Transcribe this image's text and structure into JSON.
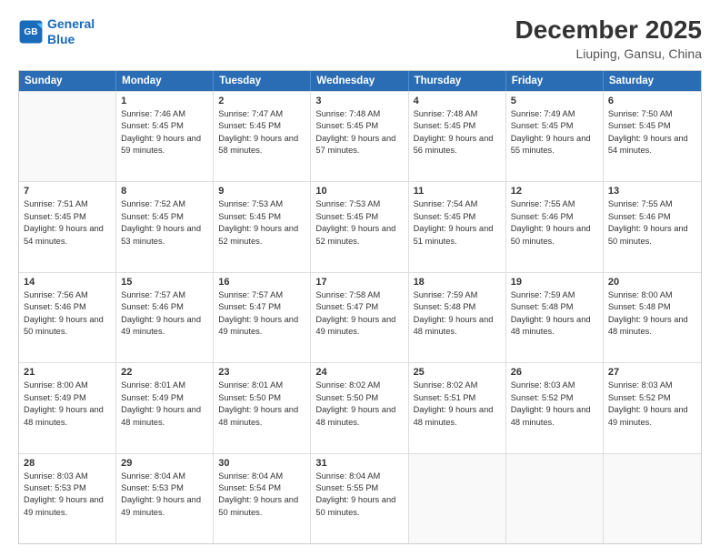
{
  "header": {
    "logo_line1": "General",
    "logo_line2": "Blue",
    "title": "December 2025",
    "subtitle": "Liuping, Gansu, China"
  },
  "weekdays": [
    "Sunday",
    "Monday",
    "Tuesday",
    "Wednesday",
    "Thursday",
    "Friday",
    "Saturday"
  ],
  "weeks": [
    [
      {
        "day": "",
        "sunrise": "",
        "sunset": "",
        "daylight": ""
      },
      {
        "day": "1",
        "sunrise": "Sunrise: 7:46 AM",
        "sunset": "Sunset: 5:45 PM",
        "daylight": "Daylight: 9 hours and 59 minutes."
      },
      {
        "day": "2",
        "sunrise": "Sunrise: 7:47 AM",
        "sunset": "Sunset: 5:45 PM",
        "daylight": "Daylight: 9 hours and 58 minutes."
      },
      {
        "day": "3",
        "sunrise": "Sunrise: 7:48 AM",
        "sunset": "Sunset: 5:45 PM",
        "daylight": "Daylight: 9 hours and 57 minutes."
      },
      {
        "day": "4",
        "sunrise": "Sunrise: 7:48 AM",
        "sunset": "Sunset: 5:45 PM",
        "daylight": "Daylight: 9 hours and 56 minutes."
      },
      {
        "day": "5",
        "sunrise": "Sunrise: 7:49 AM",
        "sunset": "Sunset: 5:45 PM",
        "daylight": "Daylight: 9 hours and 55 minutes."
      },
      {
        "day": "6",
        "sunrise": "Sunrise: 7:50 AM",
        "sunset": "Sunset: 5:45 PM",
        "daylight": "Daylight: 9 hours and 54 minutes."
      }
    ],
    [
      {
        "day": "7",
        "sunrise": "Sunrise: 7:51 AM",
        "sunset": "Sunset: 5:45 PM",
        "daylight": "Daylight: 9 hours and 54 minutes."
      },
      {
        "day": "8",
        "sunrise": "Sunrise: 7:52 AM",
        "sunset": "Sunset: 5:45 PM",
        "daylight": "Daylight: 9 hours and 53 minutes."
      },
      {
        "day": "9",
        "sunrise": "Sunrise: 7:53 AM",
        "sunset": "Sunset: 5:45 PM",
        "daylight": "Daylight: 9 hours and 52 minutes."
      },
      {
        "day": "10",
        "sunrise": "Sunrise: 7:53 AM",
        "sunset": "Sunset: 5:45 PM",
        "daylight": "Daylight: 9 hours and 52 minutes."
      },
      {
        "day": "11",
        "sunrise": "Sunrise: 7:54 AM",
        "sunset": "Sunset: 5:45 PM",
        "daylight": "Daylight: 9 hours and 51 minutes."
      },
      {
        "day": "12",
        "sunrise": "Sunrise: 7:55 AM",
        "sunset": "Sunset: 5:46 PM",
        "daylight": "Daylight: 9 hours and 50 minutes."
      },
      {
        "day": "13",
        "sunrise": "Sunrise: 7:55 AM",
        "sunset": "Sunset: 5:46 PM",
        "daylight": "Daylight: 9 hours and 50 minutes."
      }
    ],
    [
      {
        "day": "14",
        "sunrise": "Sunrise: 7:56 AM",
        "sunset": "Sunset: 5:46 PM",
        "daylight": "Daylight: 9 hours and 50 minutes."
      },
      {
        "day": "15",
        "sunrise": "Sunrise: 7:57 AM",
        "sunset": "Sunset: 5:46 PM",
        "daylight": "Daylight: 9 hours and 49 minutes."
      },
      {
        "day": "16",
        "sunrise": "Sunrise: 7:57 AM",
        "sunset": "Sunset: 5:47 PM",
        "daylight": "Daylight: 9 hours and 49 minutes."
      },
      {
        "day": "17",
        "sunrise": "Sunrise: 7:58 AM",
        "sunset": "Sunset: 5:47 PM",
        "daylight": "Daylight: 9 hours and 49 minutes."
      },
      {
        "day": "18",
        "sunrise": "Sunrise: 7:59 AM",
        "sunset": "Sunset: 5:48 PM",
        "daylight": "Daylight: 9 hours and 48 minutes."
      },
      {
        "day": "19",
        "sunrise": "Sunrise: 7:59 AM",
        "sunset": "Sunset: 5:48 PM",
        "daylight": "Daylight: 9 hours and 48 minutes."
      },
      {
        "day": "20",
        "sunrise": "Sunrise: 8:00 AM",
        "sunset": "Sunset: 5:48 PM",
        "daylight": "Daylight: 9 hours and 48 minutes."
      }
    ],
    [
      {
        "day": "21",
        "sunrise": "Sunrise: 8:00 AM",
        "sunset": "Sunset: 5:49 PM",
        "daylight": "Daylight: 9 hours and 48 minutes."
      },
      {
        "day": "22",
        "sunrise": "Sunrise: 8:01 AM",
        "sunset": "Sunset: 5:49 PM",
        "daylight": "Daylight: 9 hours and 48 minutes."
      },
      {
        "day": "23",
        "sunrise": "Sunrise: 8:01 AM",
        "sunset": "Sunset: 5:50 PM",
        "daylight": "Daylight: 9 hours and 48 minutes."
      },
      {
        "day": "24",
        "sunrise": "Sunrise: 8:02 AM",
        "sunset": "Sunset: 5:50 PM",
        "daylight": "Daylight: 9 hours and 48 minutes."
      },
      {
        "day": "25",
        "sunrise": "Sunrise: 8:02 AM",
        "sunset": "Sunset: 5:51 PM",
        "daylight": "Daylight: 9 hours and 48 minutes."
      },
      {
        "day": "26",
        "sunrise": "Sunrise: 8:03 AM",
        "sunset": "Sunset: 5:52 PM",
        "daylight": "Daylight: 9 hours and 48 minutes."
      },
      {
        "day": "27",
        "sunrise": "Sunrise: 8:03 AM",
        "sunset": "Sunset: 5:52 PM",
        "daylight": "Daylight: 9 hours and 49 minutes."
      }
    ],
    [
      {
        "day": "28",
        "sunrise": "Sunrise: 8:03 AM",
        "sunset": "Sunset: 5:53 PM",
        "daylight": "Daylight: 9 hours and 49 minutes."
      },
      {
        "day": "29",
        "sunrise": "Sunrise: 8:04 AM",
        "sunset": "Sunset: 5:53 PM",
        "daylight": "Daylight: 9 hours and 49 minutes."
      },
      {
        "day": "30",
        "sunrise": "Sunrise: 8:04 AM",
        "sunset": "Sunset: 5:54 PM",
        "daylight": "Daylight: 9 hours and 50 minutes."
      },
      {
        "day": "31",
        "sunrise": "Sunrise: 8:04 AM",
        "sunset": "Sunset: 5:55 PM",
        "daylight": "Daylight: 9 hours and 50 minutes."
      },
      {
        "day": "",
        "sunrise": "",
        "sunset": "",
        "daylight": ""
      },
      {
        "day": "",
        "sunrise": "",
        "sunset": "",
        "daylight": ""
      },
      {
        "day": "",
        "sunrise": "",
        "sunset": "",
        "daylight": ""
      }
    ]
  ]
}
